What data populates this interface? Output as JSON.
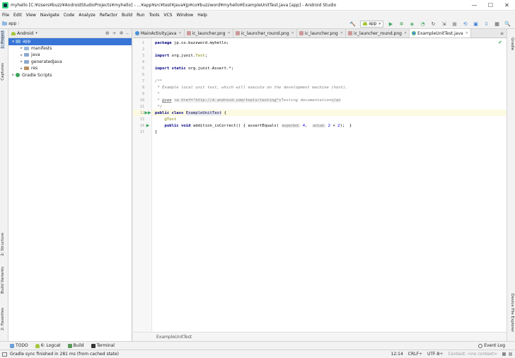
{
  "window": {
    "title": "myhello [C:¥Users¥buzz¥AndroidStudioProjects¥myhello] - ...¥app¥src¥test¥java¥jp¥co¥buzzword¥myhello¥ExampleUnitTest.java [app] - Android Studio",
    "minimize": "—",
    "maximize": "☐",
    "close": "✕"
  },
  "menu": [
    "File",
    "Edit",
    "View",
    "Navigate",
    "Code",
    "Analyze",
    "Refactor",
    "Build",
    "Run",
    "Tools",
    "VCS",
    "Window",
    "Help"
  ],
  "toolbar": {
    "breadcrumb": "app",
    "breadcrumb_sep": "〉",
    "run_config": "app",
    "run_config_caret": "▾",
    "icons": {
      "hammer": "🔨",
      "run": "▶",
      "debug": "✲",
      "coverage": "◈",
      "profile": "◔",
      "apply_changes": "↻",
      "attach": "⇲",
      "stop": "■",
      "sync": "⟲",
      "avd": "▣",
      "sdk": "⇩",
      "structure": "▦",
      "search": "🔍"
    }
  },
  "left_stripe": [
    "1: Project",
    "Captures",
    "2: Structure",
    "Build Variants",
    "2: Favorites"
  ],
  "right_stripe": [
    "Gradle",
    "Device File Explorer"
  ],
  "project_panel": {
    "view_mode": "Android",
    "caret": "▾",
    "icons": [
      "⊕",
      "÷",
      "✲",
      "–"
    ],
    "tree": [
      {
        "label": "app",
        "indent": 0,
        "expanded": true,
        "selected": true,
        "kind": "app"
      },
      {
        "label": "manifests",
        "indent": 1,
        "expanded": false,
        "selected": false,
        "kind": "folder"
      },
      {
        "label": "java",
        "indent": 1,
        "expanded": false,
        "selected": false,
        "kind": "java"
      },
      {
        "label": "generatedJava",
        "indent": 1,
        "expanded": false,
        "selected": false,
        "kind": "java"
      },
      {
        "label": "res",
        "indent": 1,
        "expanded": false,
        "selected": false,
        "kind": "res"
      },
      {
        "label": "Gradle Scripts",
        "indent": 0,
        "expanded": false,
        "selected": false,
        "kind": "gradle"
      }
    ]
  },
  "editor_tabs": [
    {
      "label": "MainActivity.java",
      "kind": "java",
      "active": false
    },
    {
      "label": "ic_launcher.png",
      "kind": "png",
      "active": false
    },
    {
      "label": "ic_launcher_round.png",
      "kind": "png",
      "active": false
    },
    {
      "label": "ic_launcher.png",
      "kind": "png",
      "active": false
    },
    {
      "label": "ic_launcher_round.png",
      "kind": "png",
      "active": false
    },
    {
      "label": "ExampleUnitTest.java",
      "kind": "test",
      "active": true
    }
  ],
  "editor_tabs_overflow": "≡",
  "code": {
    "lines": [
      {
        "n": "1",
        "segs": [
          [
            "kw",
            "package "
          ],
          [
            "ident",
            "jp.co.buzzword.myhello;"
          ]
        ]
      },
      {
        "n": "2",
        "segs": []
      },
      {
        "n": "3",
        "segs": [
          [
            "kw",
            "import "
          ],
          [
            "ident",
            "org.junit."
          ],
          [
            "ann",
            "Test"
          ],
          [
            "ident",
            ";"
          ]
        ]
      },
      {
        "n": "4",
        "segs": []
      },
      {
        "n": "5",
        "segs": [
          [
            "kw",
            "import static "
          ],
          [
            "ident",
            "org.junit.Assert.*;"
          ]
        ]
      },
      {
        "n": "6",
        "segs": []
      },
      {
        "n": "7",
        "segs": [
          [
            "cmt",
            "/**"
          ]
        ]
      },
      {
        "n": "8",
        "segs": [
          [
            "cmt",
            " * Example local unit test, which will execute on the development machine (host)."
          ]
        ]
      },
      {
        "n": "9",
        "segs": [
          [
            "cmt",
            " *"
          ]
        ]
      },
      {
        "n": "10",
        "segs": [
          [
            "cmt",
            " * "
          ],
          [
            "cmt-tag",
            "@see"
          ],
          [
            "cmt",
            " "
          ],
          [
            "cmt-html",
            "<a href=\"http://d.android.com/tools/testing\">"
          ],
          [
            "cmt",
            "Testing documentation"
          ],
          [
            "cmt-html",
            "</a>"
          ]
        ]
      },
      {
        "n": "11",
        "segs": [
          [
            "cmt",
            " */"
          ]
        ]
      },
      {
        "n": "12",
        "segs": [
          [
            "kw",
            "public class "
          ],
          [
            "cls-hl",
            "ExampleUnitTest"
          ],
          [
            "ident",
            " {"
          ]
        ],
        "current": true,
        "run": "▶▶"
      },
      {
        "n": "13",
        "segs": [
          [
            "ann",
            "    @Test"
          ]
        ]
      },
      {
        "n": "14",
        "segs": [
          [
            "kw",
            "    public void "
          ],
          [
            "ident",
            "addition_isCorrect() { assertEquals( "
          ],
          [
            "hint",
            "expected:"
          ],
          [
            "num",
            " 4"
          ],
          [
            "ident",
            ",  "
          ],
          [
            "hint",
            "actual:"
          ],
          [
            "num",
            " 2 "
          ],
          [
            "ident",
            "+ "
          ],
          [
            "num",
            "2"
          ],
          [
            "ident",
            ");  }"
          ]
        ],
        "run": "▶"
      },
      {
        "n": "17",
        "segs": [
          [
            "ident",
            "}"
          ]
        ]
      }
    ],
    "status_ok": "✔"
  },
  "editor_breadcrumb": "ExampleUnitTest",
  "bottom_tabs": [
    {
      "label": "TODO",
      "kind": "todo"
    },
    {
      "label": "6: Logcat",
      "kind": "logcat"
    },
    {
      "label": "Build",
      "kind": "build"
    },
    {
      "label": "Terminal",
      "kind": "term"
    }
  ],
  "event_log": "Event Log",
  "status": {
    "message": "Gradle sync finished in 281 ms (from cached state)",
    "position": "12:14",
    "line_sep": "CRLF÷",
    "encoding": "UTF-8÷",
    "context": "Context: <no context>"
  }
}
